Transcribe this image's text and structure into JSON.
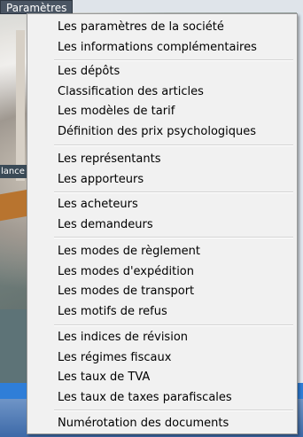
{
  "menu_bar": {
    "tab_label": "Paramètres"
  },
  "background": {
    "side_label": "lance"
  },
  "dropdown": {
    "groups": [
      [
        "Les paramètres de la société",
        "Les informations complémentaires"
      ],
      [
        "Les dépôts",
        "Classification des articles",
        "Les modèles de tarif",
        "Définition des prix psychologiques"
      ],
      [
        "Les représentants",
        "Les apporteurs"
      ],
      [
        "Les acheteurs",
        "Les demandeurs"
      ],
      [
        "Les modes de règlement",
        "Les modes d'expédition",
        "Les modes de transport",
        "Les motifs de refus"
      ],
      [
        "Les indices de révision",
        "Les régimes fiscaux",
        "Les taux de TVA",
        "Les taux de taxes parafiscales"
      ],
      [
        "Numérotation des documents"
      ]
    ]
  },
  "colors": {
    "menu_background": "#f1f1f1",
    "separator": "#d3d3d3",
    "taskbar_blue": "#2f7ed8"
  }
}
